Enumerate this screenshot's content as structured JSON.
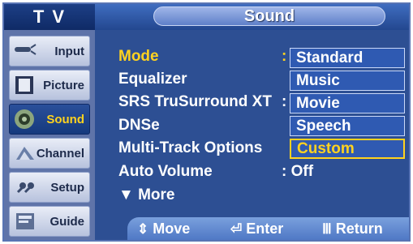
{
  "header": {
    "left_title": "T V",
    "right_title": "Sound"
  },
  "sidebar": {
    "items": [
      {
        "label": "Input",
        "icon": "input-icon",
        "active": false
      },
      {
        "label": "Picture",
        "icon": "picture-icon",
        "active": false
      },
      {
        "label": "Sound",
        "icon": "sound-icon",
        "active": true
      },
      {
        "label": "Channel",
        "icon": "channel-icon",
        "active": false
      },
      {
        "label": "Setup",
        "icon": "setup-icon",
        "active": false
      },
      {
        "label": "Guide",
        "icon": "guide-icon",
        "active": false
      }
    ]
  },
  "menu": {
    "mode_label": "Mode",
    "mode_colon": ":",
    "equalizer_label": "Equalizer",
    "srs_label": "SRS TruSurround XT",
    "srs_colon": ":",
    "dnse_label": "DNSe",
    "multitrack_label": "Multi-Track Options",
    "auto_volume_label": "Auto Volume",
    "auto_volume_value": ": Off",
    "more_label": "▼ More"
  },
  "mode_dropdown": {
    "options": [
      "Standard",
      "Music",
      "Movie",
      "Speech",
      "Custom"
    ],
    "selected": "Custom"
  },
  "footer": {
    "move_icon": "⇕",
    "move_label": "Move",
    "enter_icon": "⏎",
    "enter_label": "Enter",
    "return_icon": "Ⅲ",
    "return_label": "Return"
  },
  "colors": {
    "background": "#2d4f93",
    "highlight": "#ffd21f",
    "sidebar": "#5f74a9"
  }
}
